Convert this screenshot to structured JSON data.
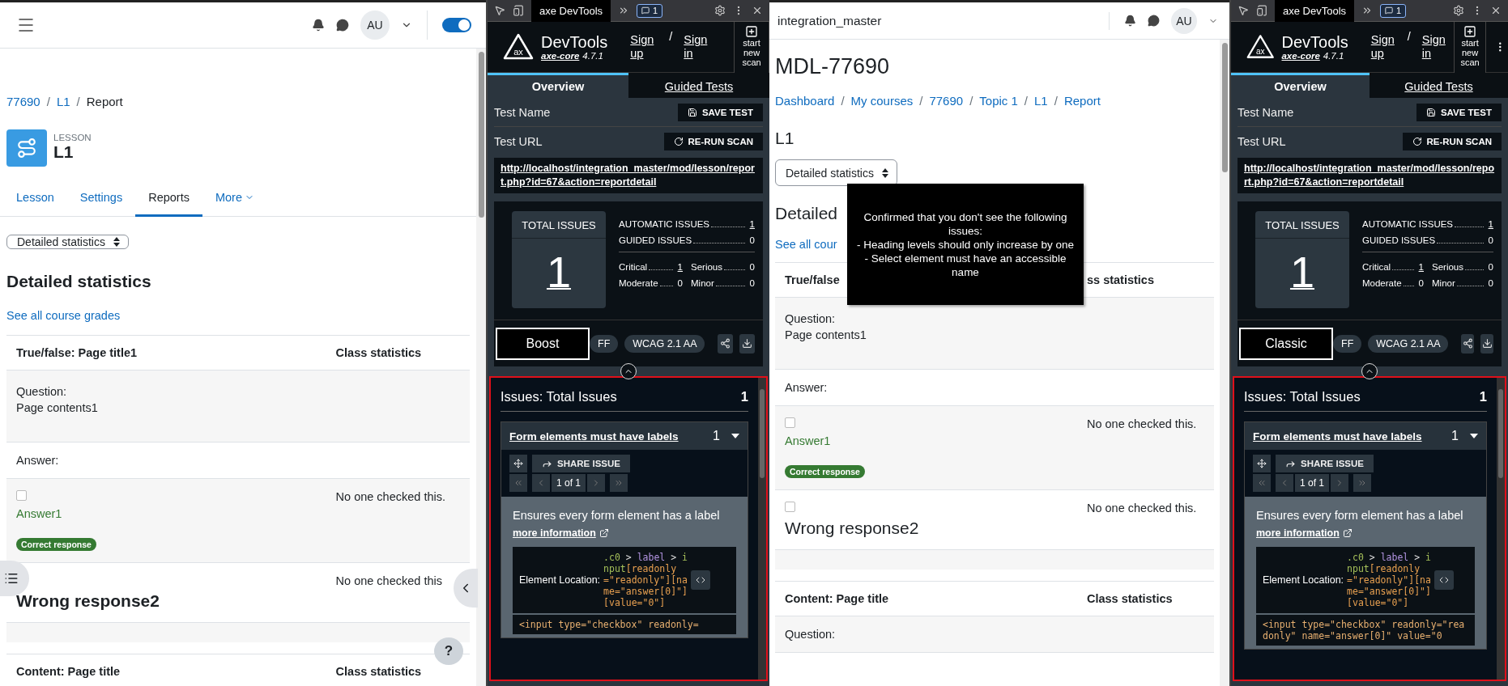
{
  "left_page": {
    "header": {
      "avatar": "AU",
      "switch_on": true
    },
    "breadcrumbs": [
      {
        "label": "77690",
        "link": true
      },
      {
        "label": "L1",
        "link": true
      },
      {
        "label": "Report",
        "link": false
      }
    ],
    "separators": [
      "/",
      "/"
    ],
    "activity": {
      "type_label": "LESSON",
      "title": "L1"
    },
    "tabs": [
      {
        "label": "Lesson",
        "selected": false
      },
      {
        "label": "Settings",
        "selected": false
      },
      {
        "label": "Reports",
        "selected": true
      },
      {
        "label": "More",
        "selected": false
      }
    ],
    "report_select": "Detailed statistics",
    "heading": "Detailed statistics",
    "grades_link": "See all course grades",
    "tables": [
      {
        "columns": [
          "True/false: Page title1",
          "Class statistics"
        ],
        "rows": [
          {
            "kind": "question",
            "label": "Question:",
            "text": "Page contents1"
          },
          {
            "kind": "label",
            "label": "Answer:"
          },
          {
            "kind": "option",
            "checked": false,
            "correct": true,
            "text": "Answer1",
            "badge": "Correct response",
            "stat": "No one checked this."
          },
          {
            "kind": "option",
            "correct": false,
            "text": "Wrong response2",
            "stat": "No one checked this"
          },
          {
            "kind": "spacer"
          }
        ]
      },
      {
        "columns": [
          "Content: Page title",
          "Class statistics"
        ]
      }
    ],
    "help": "?"
  },
  "left_devtools": {
    "toolbar": {
      "tab": "axe DevTools",
      "message_count": "1"
    },
    "logo_text": "ax",
    "brand": "DevTools",
    "engine": "axe-core",
    "version": "4.7.1",
    "auth": [
      "Sign up",
      "Sign in"
    ],
    "auth_separator": "/",
    "new_scan": "start new scan",
    "has_menu": false,
    "tabs": [
      {
        "label": "Overview",
        "selected": true
      },
      {
        "label": "Guided Tests",
        "selected": false
      }
    ],
    "test_name_label": "Test Name",
    "save_button": "SAVE TEST",
    "test_url_label": "Test URL",
    "rerun_button": "RE-RUN SCAN",
    "url": "http://localhost/integration_master/mod/lesson/report.php?id=67&action=reportdetail",
    "total": {
      "label": "TOTAL ISSUES",
      "value": "1"
    },
    "counts": [
      {
        "label": "AUTOMATIC ISSUES",
        "value": "1",
        "link": true
      },
      {
        "label": "GUIDED ISSUES",
        "value": "0",
        "link": false
      }
    ],
    "severities": [
      {
        "label": "Critical",
        "value": "1",
        "link": true
      },
      {
        "label": "Serious",
        "value": "0",
        "link": false
      },
      {
        "label": "Moderate",
        "value": "0",
        "link": false
      },
      {
        "label": "Minor",
        "value": "0",
        "link": false
      }
    ],
    "chips": [
      "FF",
      "WCAG 2.1 AA"
    ],
    "overlay_label": "Boost",
    "issues": {
      "title": "Issues: Total Issues",
      "count": "1",
      "items": [
        {
          "title": "Form elements must have labels",
          "count": "1",
          "expanded": true,
          "share_button": "SHARE ISSUE",
          "pager": "1 of 1",
          "description": "Ensures every form element has a label",
          "more_link": "more information",
          "location_label": "Element Location:",
          "selector": [
            {
              "kind": "class",
              "text": ".c0"
            },
            {
              "kind": "op",
              "text": " > "
            },
            {
              "kind": "tag",
              "text": "label"
            },
            {
              "kind": "op",
              "text": " > "
            },
            {
              "kind": "element",
              "text": "input"
            },
            {
              "kind": "attr",
              "text": "[readonly=\"readonly\"][name=\"answer[0]\"][value=\"0\"]"
            }
          ],
          "code": "<input type=\"checkbox\" readonly="
        }
      ]
    }
  },
  "middle_page": {
    "site_name": "integration_master",
    "header": {
      "avatar": "AU"
    },
    "course_title": "MDL-77690",
    "breadcrumbs": [
      {
        "label": "Dashboard",
        "link": true
      },
      {
        "label": "My courses",
        "link": true
      },
      {
        "label": "77690",
        "link": true
      },
      {
        "label": "Topic 1",
        "link": true
      },
      {
        "label": "L1",
        "link": true
      },
      {
        "label": "Report",
        "link": true
      }
    ],
    "separators": [
      "/",
      "/",
      "/",
      "/",
      "/"
    ],
    "page_title": "L1",
    "report_select": "Detailed statistics",
    "heading": "Detailed",
    "grades_link": "See all cour",
    "tables": [
      {
        "columns": [
          "True/false",
          "ss statistics"
        ],
        "rows": [
          {
            "kind": "question",
            "label": "Question:",
            "text": "Page contents1"
          },
          {
            "kind": "label",
            "label": "Answer:"
          },
          {
            "kind": "option",
            "checked": false,
            "correct": true,
            "text": "Answer1",
            "badge": "Correct response",
            "stat": "No one checked this."
          },
          {
            "kind": "option",
            "checked": false,
            "correct": false,
            "text": "Wrong response2",
            "stat": "No one checked this."
          },
          {
            "kind": "spacer"
          }
        ]
      },
      {
        "columns": [
          "Content: Page title",
          "Class statistics"
        ],
        "rows": [
          {
            "kind": "label",
            "label": "Question:"
          }
        ]
      }
    ],
    "tooltip": {
      "lines": [
        "Confirmed that you don't see the following issues:",
        "- Heading levels should only increase by one",
        "- Select element must have an accessible name"
      ]
    }
  },
  "right_devtools": {
    "toolbar": {
      "tab": "axe DevTools",
      "message_count": "1"
    },
    "logo_text": "ax",
    "brand": "DevTools",
    "engine": "axe-core",
    "version": "4.7.1",
    "auth": [
      "Sign up",
      "Sign in"
    ],
    "auth_separator": "/",
    "new_scan": "start new scan",
    "has_menu": true,
    "tabs": [
      {
        "label": "Overview",
        "selected": true
      },
      {
        "label": "Guided Tests",
        "selected": false
      }
    ],
    "test_name_label": "Test Name",
    "save_button": "SAVE TEST",
    "test_url_label": "Test URL",
    "rerun_button": "RE-RUN SCAN",
    "url": "http://localhost/integration_master/mod/lesson/report.php?id=67&action=reportdetail",
    "total": {
      "label": "TOTAL ISSUES",
      "value": "1"
    },
    "counts": [
      {
        "label": "AUTOMATIC ISSUES",
        "value": "1",
        "link": true
      },
      {
        "label": "GUIDED ISSUES",
        "value": "0",
        "link": false
      }
    ],
    "severities": [
      {
        "label": "Critical",
        "value": "1",
        "link": true
      },
      {
        "label": "Serious",
        "value": "0",
        "link": false
      },
      {
        "label": "Moderate",
        "value": "0",
        "link": false
      },
      {
        "label": "Minor",
        "value": "0",
        "link": false
      }
    ],
    "chips": [
      "FF",
      "WCAG 2.1 AA"
    ],
    "overlay_label": "Classic",
    "issues": {
      "title": "Issues: Total Issues",
      "count": "1",
      "items": [
        {
          "title": "Form elements must have labels",
          "count": "1",
          "expanded": true,
          "share_button": "SHARE ISSUE",
          "pager": "1 of 1",
          "description": "Ensures every form element has a label",
          "more_link": "more information",
          "location_label": "Element Location:",
          "selector": [
            {
              "kind": "class",
              "text": ".c0"
            },
            {
              "kind": "op",
              "text": " > "
            },
            {
              "kind": "tag",
              "text": "label"
            },
            {
              "kind": "op",
              "text": " > "
            },
            {
              "kind": "element",
              "text": "input"
            },
            {
              "kind": "attr",
              "text": "[readonly=\"readonly\"][name=\"answer[0]\"][value=\"0\"]"
            }
          ],
          "code": "<input type=\"checkbox\" readonly=\"readonly\" name=\"answer[0]\" value=\"0"
        }
      ]
    }
  }
}
